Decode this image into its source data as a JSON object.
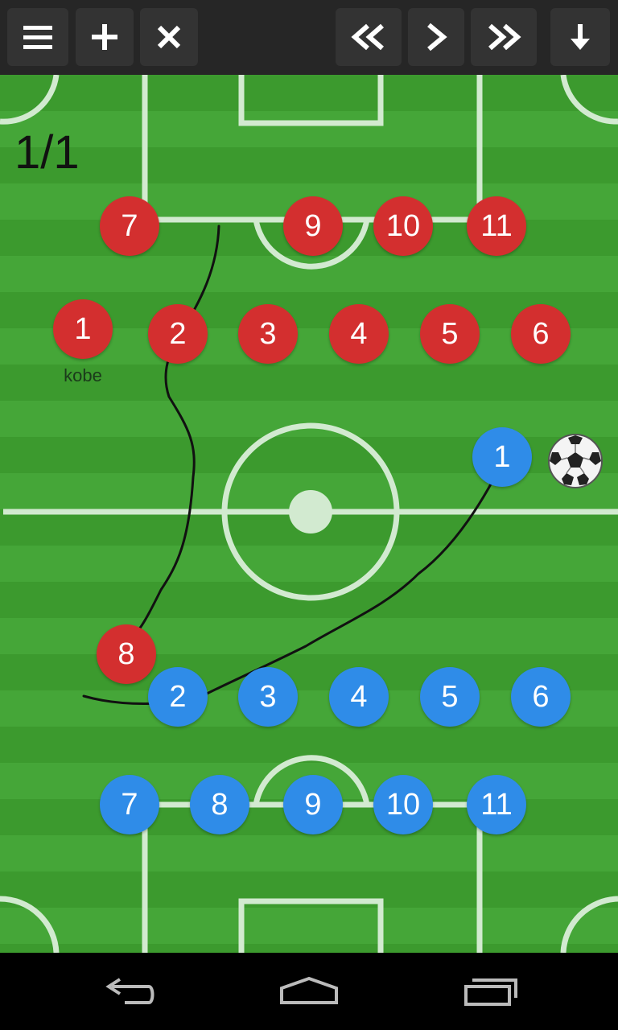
{
  "toolbar": {
    "buttons": [
      {
        "name": "menu-button",
        "icon": "menu-icon"
      },
      {
        "name": "add-button",
        "icon": "plus-icon"
      },
      {
        "name": "delete-button",
        "icon": "close-icon"
      },
      {
        "name": "rewind-button",
        "icon": "rewind-icon"
      },
      {
        "name": "play-button",
        "icon": "play-icon"
      },
      {
        "name": "fast-forward-button",
        "icon": "fast-forward-icon"
      },
      {
        "name": "download-button",
        "icon": "arrow-down-icon"
      }
    ]
  },
  "field": {
    "frame_counter": "1/1",
    "colors": {
      "stripe_dark": "#3c9a2e",
      "stripe_light": "#45a638",
      "line": "#cfe8c8",
      "red_team": "#d32f2f",
      "blue_team": "#2f8ce8"
    }
  },
  "red_team": {
    "players": [
      {
        "number": "7"
      },
      {
        "number": "9"
      },
      {
        "number": "10"
      },
      {
        "number": "11"
      },
      {
        "number": "1",
        "label": "kobe"
      },
      {
        "number": "2"
      },
      {
        "number": "3"
      },
      {
        "number": "4"
      },
      {
        "number": "5"
      },
      {
        "number": "6"
      },
      {
        "number": "8"
      }
    ]
  },
  "blue_team": {
    "players": [
      {
        "number": "1"
      },
      {
        "number": "2"
      },
      {
        "number": "3"
      },
      {
        "number": "4"
      },
      {
        "number": "5"
      },
      {
        "number": "6"
      },
      {
        "number": "7"
      },
      {
        "number": "8"
      },
      {
        "number": "9"
      },
      {
        "number": "10"
      },
      {
        "number": "11"
      }
    ]
  },
  "ball": {
    "icon": "soccer-ball-icon"
  },
  "navbar": {
    "buttons": [
      {
        "name": "nav-back-button",
        "icon": "back-icon"
      },
      {
        "name": "nav-home-button",
        "icon": "home-icon"
      },
      {
        "name": "nav-recents-button",
        "icon": "recents-icon"
      }
    ]
  }
}
